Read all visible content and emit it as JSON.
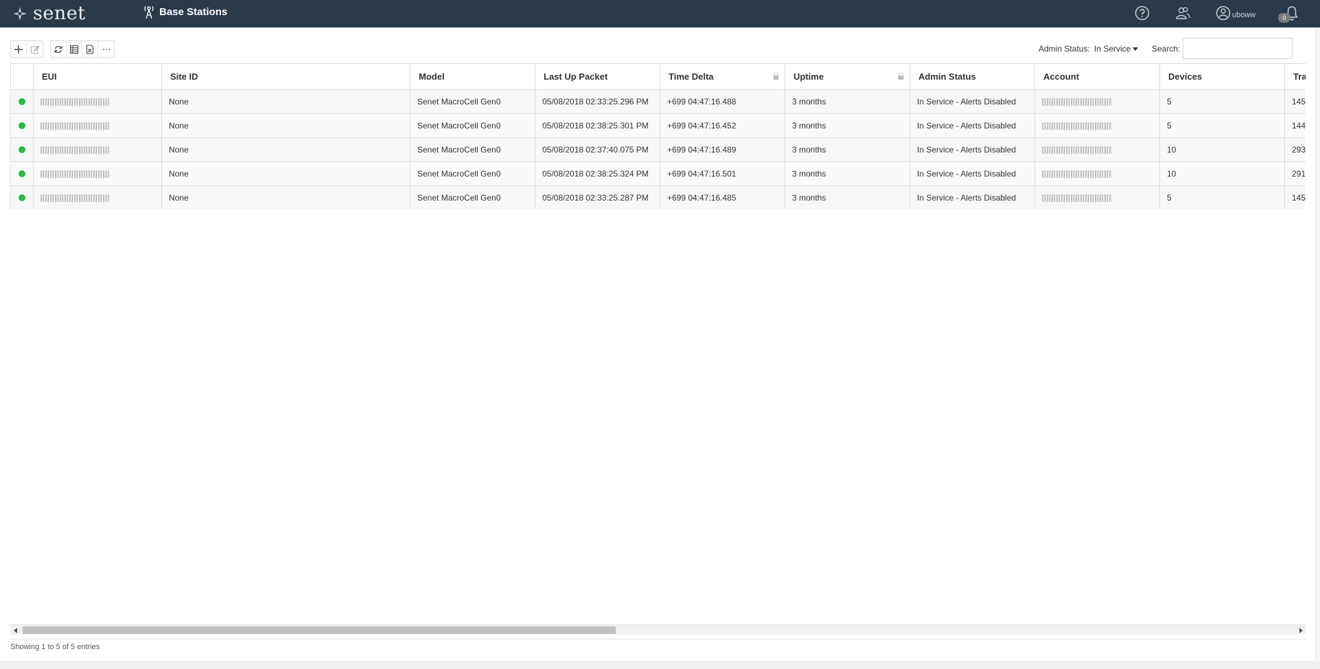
{
  "header": {
    "logo_text": "senet",
    "page_title": "Base Stations",
    "user_name": "uboww",
    "notification_count": "0"
  },
  "toolbar": {
    "buttons": [
      "add-icon",
      "edit-icon",
      "refresh-icon",
      "columns-icon",
      "export-excel-icon",
      "more-icon"
    ],
    "admin_status_label": "Admin Status:",
    "admin_status_value": "In Service",
    "search_label": "Search:",
    "search_value": ""
  },
  "table": {
    "columns": [
      "",
      "EUI",
      "Site ID",
      "Model",
      "Last Up Packet",
      "Time Delta",
      "Uptime",
      "Admin Status",
      "Account",
      "Devices",
      "Tra"
    ],
    "rows": [
      {
        "status": "green",
        "eui": "",
        "site_id": "None",
        "model": "Senet MacroCell Gen0",
        "last_up_packet": "05/08/2018 02:33:25.296 PM",
        "time_delta": "+699 04:47:16.488",
        "uptime": "3 months",
        "admin_status": "In Service - Alerts Disabled",
        "account": "",
        "devices": "5",
        "tra": "145"
      },
      {
        "status": "green",
        "eui": "",
        "site_id": "None",
        "model": "Senet MacroCell Gen0",
        "last_up_packet": "05/08/2018 02:38:25.301 PM",
        "time_delta": "+699 04:47:16.452",
        "uptime": "3 months",
        "admin_status": "In Service - Alerts Disabled",
        "account": "",
        "devices": "5",
        "tra": "144"
      },
      {
        "status": "green",
        "eui": "",
        "site_id": "None",
        "model": "Senet MacroCell Gen0",
        "last_up_packet": "05/08/2018 02:37:40.075 PM",
        "time_delta": "+699 04:47:16.489",
        "uptime": "3 months",
        "admin_status": "In Service - Alerts Disabled",
        "account": "",
        "devices": "10",
        "tra": "293"
      },
      {
        "status": "green",
        "eui": "",
        "site_id": "None",
        "model": "Senet MacroCell Gen0",
        "last_up_packet": "05/08/2018 02:38:25.324 PM",
        "time_delta": "+699 04:47:16.501",
        "uptime": "3 months",
        "admin_status": "In Service - Alerts Disabled",
        "account": "",
        "devices": "10",
        "tra": "291"
      },
      {
        "status": "green",
        "eui": "",
        "site_id": "None",
        "model": "Senet MacroCell Gen0",
        "last_up_packet": "05/08/2018 02:33:25.287 PM",
        "time_delta": "+699 04:47:16.485",
        "uptime": "3 months",
        "admin_status": "In Service - Alerts Disabled",
        "account": "",
        "devices": "5",
        "tra": "145"
      }
    ]
  },
  "footer": {
    "info_text": "Showing 1 to 5 of 5 entries"
  },
  "colors": {
    "header_bg": "#2b3a4a",
    "status_green": "#2db845"
  }
}
